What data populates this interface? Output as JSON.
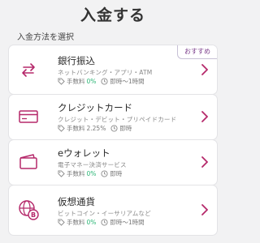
{
  "header": {
    "title": "入金する"
  },
  "section_label": "入金方法を選択",
  "methods": [
    {
      "name": "銀行振込",
      "desc": "ネットバンキング・アプリ・ATM",
      "fee_label": "手数料",
      "fee_value": "0%",
      "speed": "即時〜1時間",
      "badge": "おすすめ",
      "icon": "transfer-arrows-icon"
    },
    {
      "name": "クレジットカード",
      "desc": "クレジット・デビット・プリペイドカード",
      "fee_label": "手数料",
      "fee_value": "2.25%",
      "speed": "即時",
      "icon": "credit-card-icon"
    },
    {
      "name": "eウォレット",
      "desc": "電子マネー決済サービス",
      "fee_label": "手数料",
      "fee_value": "0%",
      "speed": "即時",
      "icon": "wallet-icon"
    },
    {
      "name": "仮想通貨",
      "desc": "ビットコイン・イーサリアムなど",
      "fee_label": "手数料",
      "fee_value": "0%",
      "speed": "即時〜1時間",
      "icon": "crypto-globe-icon"
    }
  ],
  "colors": {
    "accent": "#b5286a",
    "fee_green": "#2cb676",
    "badge_text": "#7a3b8a"
  }
}
